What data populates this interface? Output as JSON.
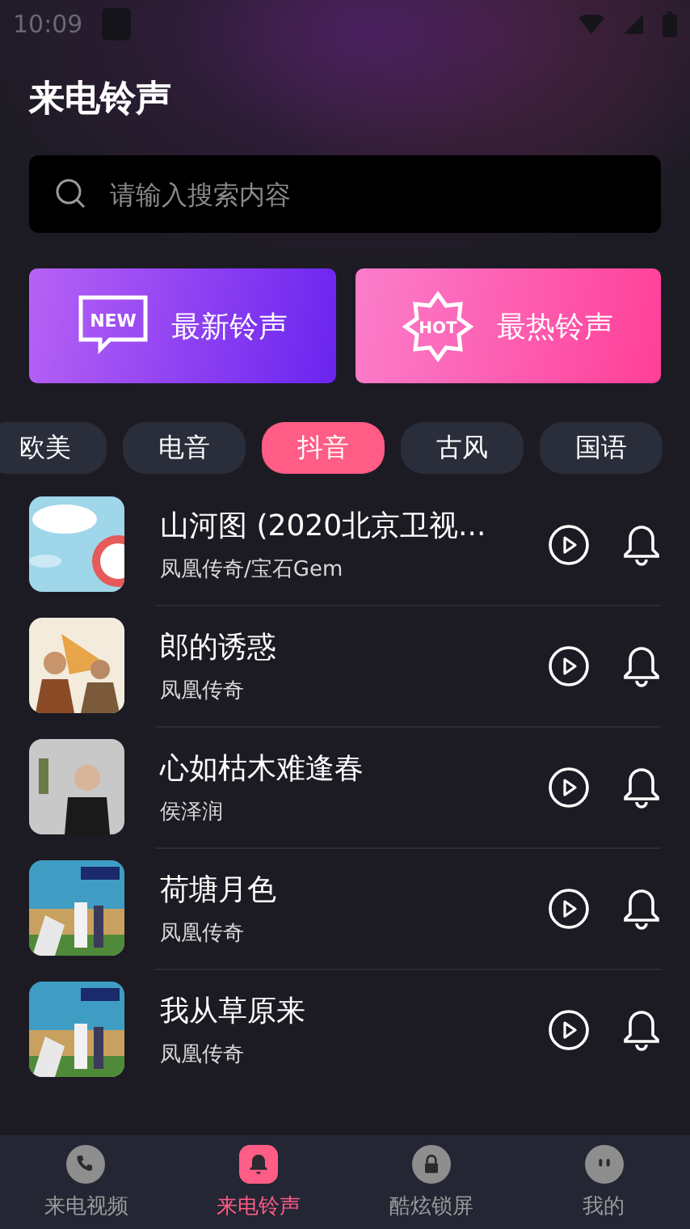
{
  "status_bar": {
    "time": "10:09"
  },
  "header": {
    "title": "来电铃声"
  },
  "search": {
    "placeholder": "请输入搜索内容"
  },
  "banners": [
    {
      "kind": "new",
      "badge": "NEW",
      "label": "最新铃声"
    },
    {
      "kind": "hot",
      "badge": "HOT",
      "label": "最热铃声"
    }
  ],
  "categories": [
    {
      "label": "欧美",
      "selected": false
    },
    {
      "label": "电音",
      "selected": false
    },
    {
      "label": "抖音",
      "selected": true
    },
    {
      "label": "古风",
      "selected": false
    },
    {
      "label": "国语",
      "selected": false
    }
  ],
  "songs": [
    {
      "title": "山河图 (2020北京卫视...",
      "artist": "凤凰传奇/宝石Gem"
    },
    {
      "title": "郎的诱惑",
      "artist": "凤凰传奇"
    },
    {
      "title": "心如枯木难逢春",
      "artist": "侯泽润"
    },
    {
      "title": "荷塘月色",
      "artist": "凤凰传奇"
    },
    {
      "title": "我从草原来",
      "artist": "凤凰传奇"
    }
  ],
  "nav": [
    {
      "kind": "phone",
      "label": "来电视频",
      "selected": false
    },
    {
      "kind": "bell",
      "label": "来电铃声",
      "selected": true
    },
    {
      "kind": "lock",
      "label": "酷炫锁屏",
      "selected": false
    },
    {
      "kind": "face",
      "label": "我的",
      "selected": false
    }
  ]
}
